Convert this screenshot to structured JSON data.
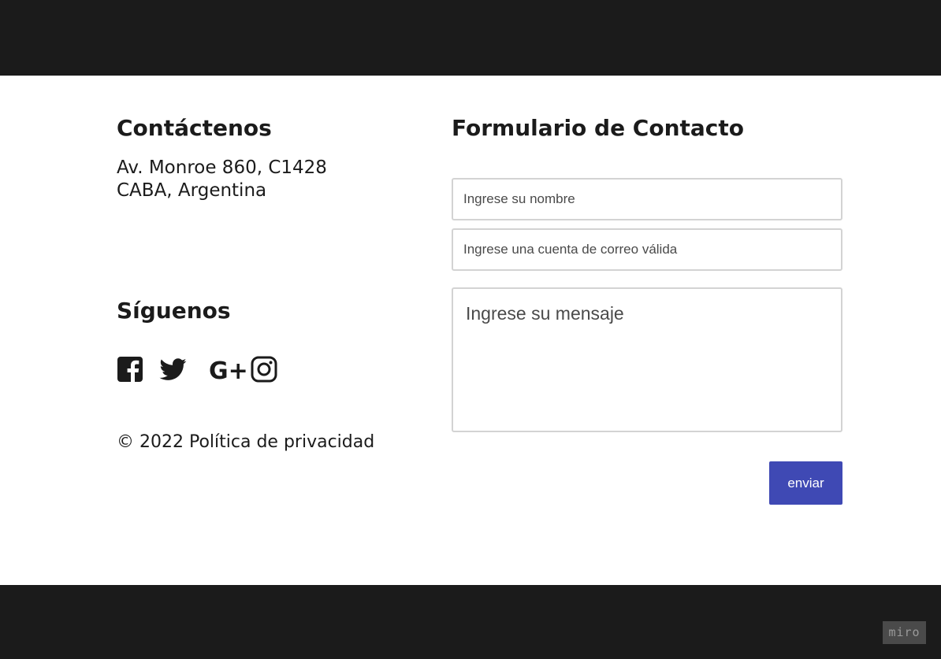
{
  "contact": {
    "title": "Contáctenos",
    "address_line1": "Av. Monroe 860, C1428",
    "address_line2": "CABA, Argentina"
  },
  "follow": {
    "title": "Síguenos",
    "icons": [
      "facebook-icon",
      "twitter-icon",
      "google-plus-icon",
      "instagram-icon"
    ],
    "gplus_label": "G+"
  },
  "footer": {
    "copyright": "© 2022 Política de privacidad"
  },
  "form": {
    "title": "Formulario de Contacto",
    "name_placeholder": "Ingrese su nombre",
    "email_placeholder": "Ingrese una cuenta de correo válida",
    "message_placeholder": "Ingrese su mensaje",
    "submit_label": "enviar"
  },
  "badge": {
    "label": "miro"
  },
  "colors": {
    "bars": "#1b1b1b",
    "button": "#3f49b4",
    "text": "#1b1b1b",
    "field_border": "#d3d3d3"
  }
}
